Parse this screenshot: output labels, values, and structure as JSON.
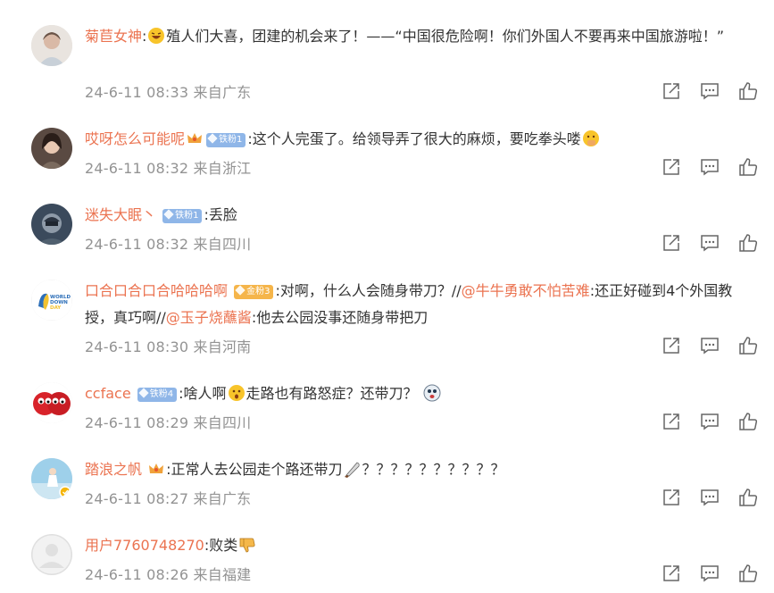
{
  "comments": [
    {
      "user": "菊苣女神",
      "badge": "",
      "text_parts": [
        "殖人们大喜，团建的机会来了！——“中国很危险啊！你们外国人不要再来中国旅游啦！”"
      ],
      "time": "24-6-11 08:33",
      "location": "来自广东"
    },
    {
      "user": "哎呀怎么可能呢",
      "badge": "铁粉1",
      "text_parts": [
        ":这个人完蛋了。给领导弄了很大的麻烦，要吃拳头喽"
      ],
      "time": "24-6-11 08:32",
      "location": "来自浙江"
    },
    {
      "user": "迷失大眠丶",
      "badge": "铁粉1",
      "text_parts": [
        ":丢脸"
      ],
      "time": "24-6-11 08:32",
      "location": "来自四川"
    },
    {
      "user": "口合口合口合哈哈哈啊",
      "badge": "金粉3",
      "text_parts": [
        ":对啊，什么人会随身带刀？//",
        "@牛牛勇敢不怕苦难",
        ":还正好碰到4个外国教授，真巧啊//",
        "@玉子烧蘸酱",
        ":他去公园没事还随身带把刀"
      ],
      "time": "24-6-11 08:30",
      "location": "来自河南"
    },
    {
      "user": "ccface",
      "badge": "铁粉4",
      "text_parts": [
        ":啥人啊",
        "走路也有路怒症？还带刀？"
      ],
      "time": "24-6-11 08:29",
      "location": "来自四川"
    },
    {
      "user": "踏浪之帆",
      "badge": "",
      "text_parts": [
        ":正常人去公园走个路还带刀",
        "？？？？？？？？？？"
      ],
      "time": "24-6-11 08:27",
      "location": "来自广东"
    },
    {
      "user": "用户7760748270",
      "badge": "",
      "text_parts": [
        ":败类"
      ],
      "time": "24-6-11 08:26",
      "location": "来自福建"
    }
  ],
  "icons": {
    "share": "share-icon",
    "comment": "comment-icon",
    "like": "like-icon"
  },
  "colors": {
    "username": "#eb7350",
    "meta": "#939393",
    "text": "#333333"
  }
}
